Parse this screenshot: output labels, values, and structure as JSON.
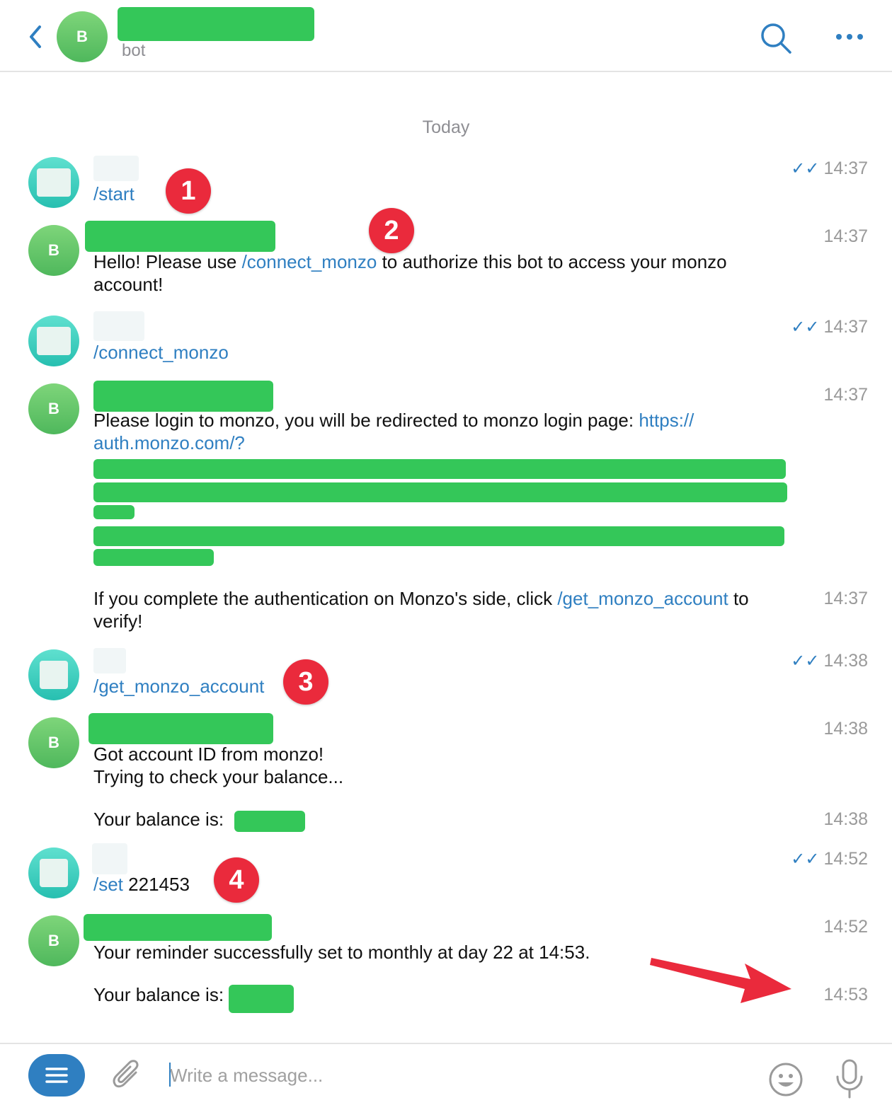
{
  "header": {
    "avatar_letter": "B",
    "subtitle": "bot"
  },
  "chat": {
    "date_label": "Today",
    "messages": [
      {
        "sender": "user",
        "command": "/start",
        "time": "14:37",
        "read": true
      },
      {
        "sender": "bot",
        "avatar_letter": "B",
        "text_before": "Hello! Please use ",
        "link": "/connect_monzo",
        "text_after": " to authorize this bot to access your monzo account!",
        "time": "14:37"
      },
      {
        "sender": "user",
        "command": "/connect_monzo",
        "time": "14:37",
        "read": true
      },
      {
        "sender": "bot",
        "avatar_letter": "B",
        "text_before": "Please login to monzo, you will be redirected to monzo login page: ",
        "link": "https:// auth.monzo.com/?",
        "time": "14:37"
      },
      {
        "sender": "bot",
        "text_before": "If you complete the authentication on Monzo's side, click ",
        "link": "/get_monzo_account",
        "text_after": " to verify!",
        "time": "14:37"
      },
      {
        "sender": "user",
        "command": "/get_monzo_account",
        "time": "14:38",
        "read": true
      },
      {
        "sender": "bot",
        "avatar_letter": "B",
        "line1": "Got account ID from monzo!",
        "line2": "Trying to check your balance...",
        "time": "14:38"
      },
      {
        "sender": "bot",
        "text": "Your balance is: ",
        "time": "14:38"
      },
      {
        "sender": "user",
        "command": "/set",
        "argument": " 221453",
        "time": "14:52",
        "read": true
      },
      {
        "sender": "bot",
        "avatar_letter": "B",
        "text": "Your reminder successfully set to monthly at day 22 at 14:53.",
        "time": "14:52"
      },
      {
        "sender": "bot",
        "text": "Your balance is:",
        "time": "14:53"
      }
    ]
  },
  "annotations": [
    "1",
    "2",
    "3",
    "4"
  ],
  "composer": {
    "placeholder": "Write a message..."
  },
  "colors": {
    "accent": "#2f7fc1",
    "redaction": "#34c759",
    "badge": "#ea2a3c",
    "bot_avatar": "#5cc265",
    "user_avatar": "#3fd0bf"
  },
  "icons": [
    "back-chevron-icon",
    "search-icon",
    "more-icon",
    "menu-icon",
    "paperclip-icon",
    "emoji-icon",
    "microphone-icon",
    "double-check-icon",
    "red-arrow"
  ]
}
